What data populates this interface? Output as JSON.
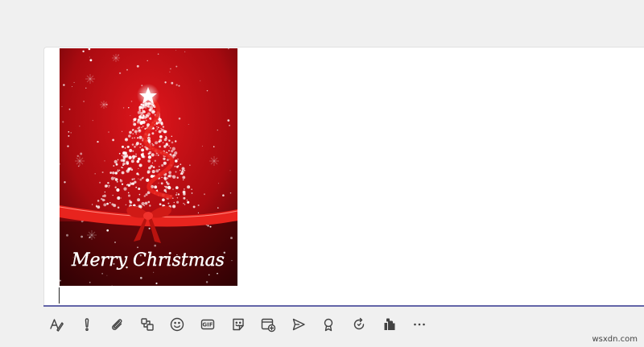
{
  "compose": {
    "card": {
      "text": "Merry Christmas",
      "colors": {
        "background_center": "#e0161c",
        "background_edge": "#3a0305",
        "ribbon": "#e8241e",
        "sparkle": "#ffffff"
      }
    },
    "accent_color": "#6264a7"
  },
  "toolbar": {
    "tools": [
      {
        "icon": "format-icon"
      },
      {
        "icon": "important-icon"
      },
      {
        "icon": "attach-icon"
      },
      {
        "icon": "loop-component-icon"
      },
      {
        "icon": "emoji-icon"
      },
      {
        "icon": "gif-icon",
        "label": "GIF"
      },
      {
        "icon": "sticker-icon"
      },
      {
        "icon": "schedule-meeting-icon"
      },
      {
        "icon": "stream-icon"
      },
      {
        "icon": "praise-icon"
      },
      {
        "icon": "update-icon"
      },
      {
        "icon": "apps-icon"
      },
      {
        "icon": "more-options-icon"
      }
    ]
  },
  "watermark": "wsxdn.com"
}
